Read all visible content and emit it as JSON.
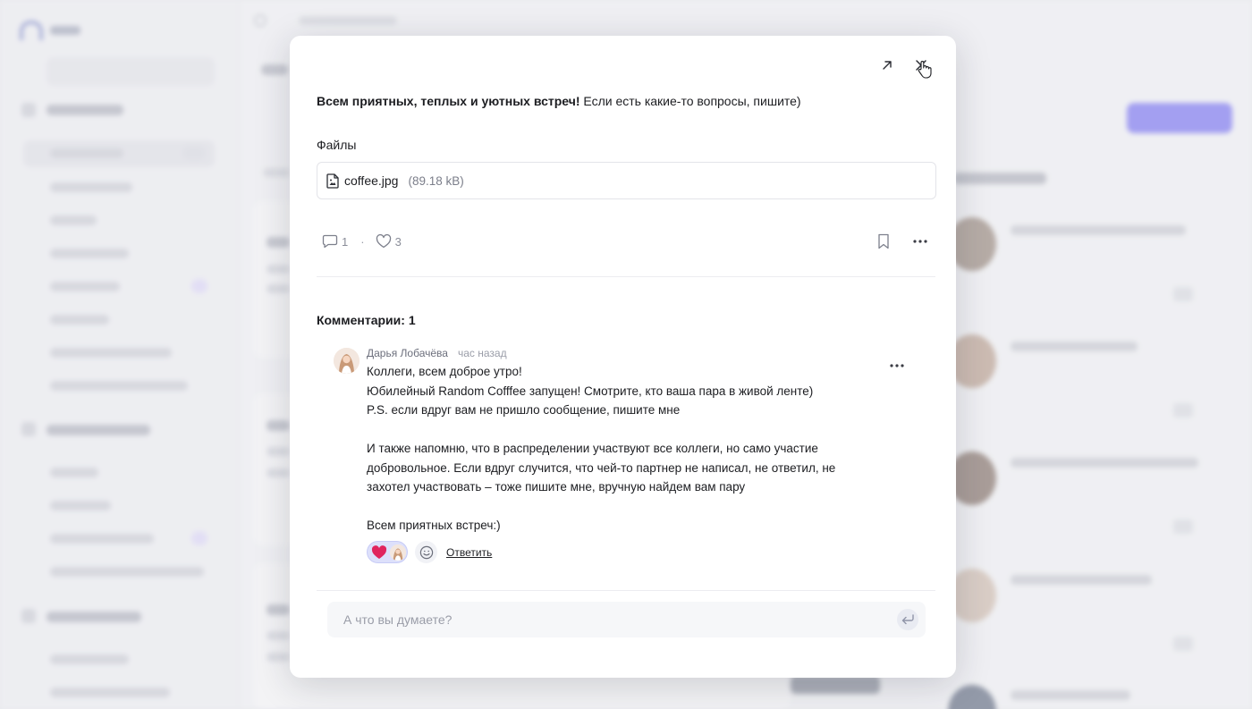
{
  "post": {
    "bold_text": "Всем приятных, теплых и уютных встреч!",
    "rest_text": " Если есть какие-то вопросы, пишите)"
  },
  "files": {
    "label": "Файлы",
    "items": [
      {
        "name": "coffee.jpg",
        "size": "(89.18 kB)",
        "icon": "file-image-icon"
      }
    ]
  },
  "stats": {
    "comments_count": "1",
    "separator": "·",
    "likes_count": "3"
  },
  "comments": {
    "title": "Комментарии: 1",
    "items": [
      {
        "author": "Дарья Лобачёва",
        "time": "час назад",
        "lines": [
          "Коллеги, всем доброе утро!",
          "Юбилейный Random Cofffee запущен! Смотрите, кто ваша пара в живой ленте)",
          "P.S. если вдруг вам не пришло сообщение, пишите мне",
          "",
          "И также напомню, что в распределении участвуют все коллеги, но само участие",
          "добровольное. Если вдруг случится, что чей-то партнер не написал, не ответил, не",
          "захотел участвовать – тоже пишите мне, вручную найдем вам пару",
          "",
          "Всем приятных встреч:)"
        ],
        "reaction_emoji": "❤️",
        "reply_label": "Ответить"
      }
    ]
  },
  "input": {
    "placeholder": "А что вы думаете?"
  },
  "colors": {
    "accent": "#6a63f5",
    "reaction_bg": "#dde0fb",
    "heart": "#e0245e"
  }
}
